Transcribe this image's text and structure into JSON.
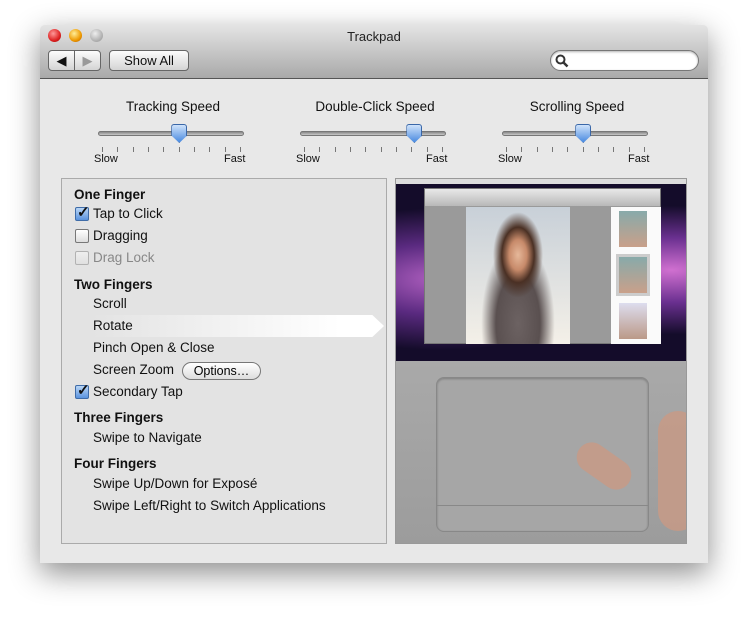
{
  "window": {
    "title": "Trackpad",
    "show_all": "Show All",
    "search": {
      "placeholder": "",
      "value": ""
    }
  },
  "sliders": [
    {
      "label": "Tracking Speed",
      "min_label": "Slow",
      "max_label": "Fast",
      "value": 0.56,
      "ticks": 10
    },
    {
      "label": "Double-Click Speed",
      "min_label": "Slow",
      "max_label": "Fast",
      "value": 0.8,
      "ticks": 10
    },
    {
      "label": "Scrolling Speed",
      "min_label": "Slow",
      "max_label": "Fast",
      "value": 0.56,
      "ticks": 10
    }
  ],
  "gestures": {
    "one_finger": {
      "header": "One Finger",
      "tap_to_click": {
        "label": "Tap to Click",
        "checked": true
      },
      "dragging": {
        "label": "Dragging",
        "checked": false
      },
      "drag_lock": {
        "label": "Drag Lock",
        "checked": false,
        "disabled": true
      }
    },
    "two_fingers": {
      "header": "Two Fingers",
      "items": [
        "Scroll",
        "Rotate",
        "Pinch Open & Close",
        "Screen Zoom"
      ],
      "selected": "Rotate",
      "options_button": "Options…",
      "secondary_tap": {
        "label": "Secondary Tap",
        "checked": true
      }
    },
    "three_fingers": {
      "header": "Three Fingers",
      "items": [
        "Swipe to Navigate"
      ]
    },
    "four_fingers": {
      "header": "Four Fingers",
      "items": [
        "Swipe Up/Down for Exposé",
        "Swipe Left/Right to Switch Applications"
      ]
    }
  },
  "colors": {
    "accent": "#4b8be0",
    "close": "#e0443a",
    "minimize": "#f0a020",
    "zoom": "#b8b8b8"
  }
}
